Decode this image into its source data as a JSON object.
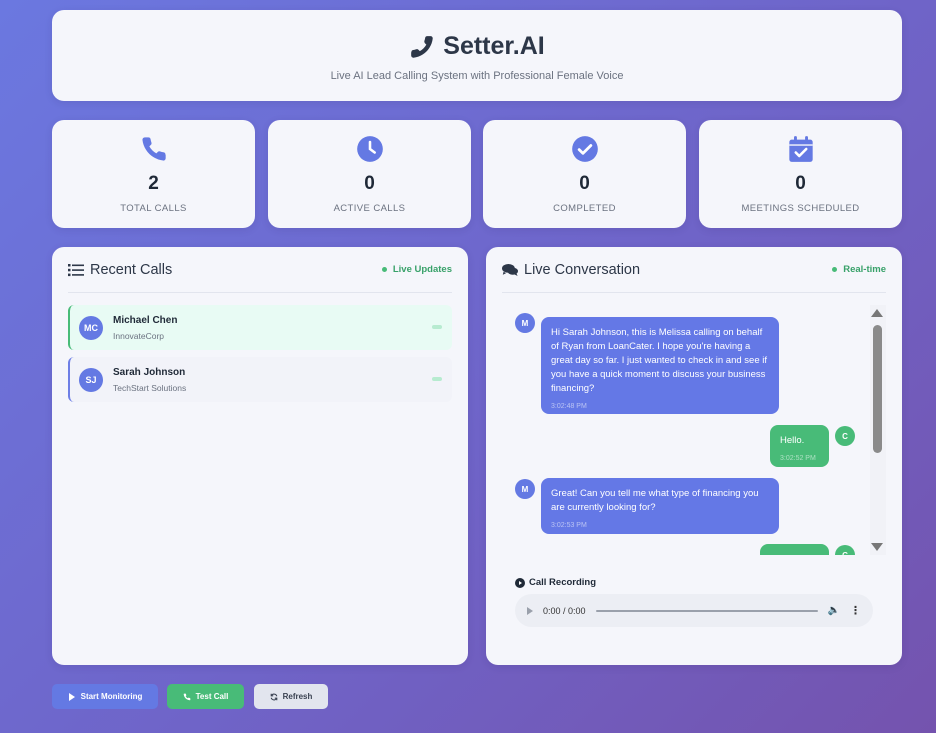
{
  "header": {
    "title": "Setter.AI",
    "subtitle": "Live AI Lead Calling System with Professional Female Voice"
  },
  "stats": [
    {
      "icon": "phone-icon",
      "value": "2",
      "label": "TOTAL CALLS"
    },
    {
      "icon": "clock-icon",
      "value": "0",
      "label": "ACTIVE CALLS"
    },
    {
      "icon": "check-circle-icon",
      "value": "0",
      "label": "COMPLETED"
    },
    {
      "icon": "calendar-check-icon",
      "value": "0",
      "label": "MEETINGS SCHEDULED"
    }
  ],
  "recent_calls": {
    "title": "Recent Calls",
    "badge": "Live Updates",
    "items": [
      {
        "initials": "MC",
        "name": "Michael Chen",
        "company": "InnovateCorp",
        "active": true
      },
      {
        "initials": "SJ",
        "name": "Sarah Johnson",
        "company": "TechStart Solutions",
        "active": false
      }
    ]
  },
  "conversation": {
    "title": "Live Conversation",
    "badge": "Real-time",
    "messages": [
      {
        "sender": "M",
        "role": "ai",
        "text": "Hi Sarah Johnson, this is Melissa calling on behalf of Ryan from LoanCater. I hope you're having a great day so far. I just wanted to check in and see if you have a quick moment to discuss your business financing?",
        "time": "3:02:48 PM"
      },
      {
        "sender": "C",
        "role": "customer",
        "text": "Hello.",
        "time": "3:02:52 PM"
      },
      {
        "sender": "M",
        "role": "ai",
        "text": "Great! Can you tell me what type of financing you are currently looking for?",
        "time": "3:02:53 PM"
      },
      {
        "sender": "C",
        "role": "customer",
        "text": "",
        "time": ""
      }
    ]
  },
  "recording": {
    "title": "Call Recording",
    "time": "0:00 / 0:00"
  },
  "buttons": {
    "start": "Start Monitoring",
    "test": "Test Call",
    "refresh": "Refresh"
  },
  "colors": {
    "accent": "#6479e3",
    "success": "#48bb78"
  }
}
